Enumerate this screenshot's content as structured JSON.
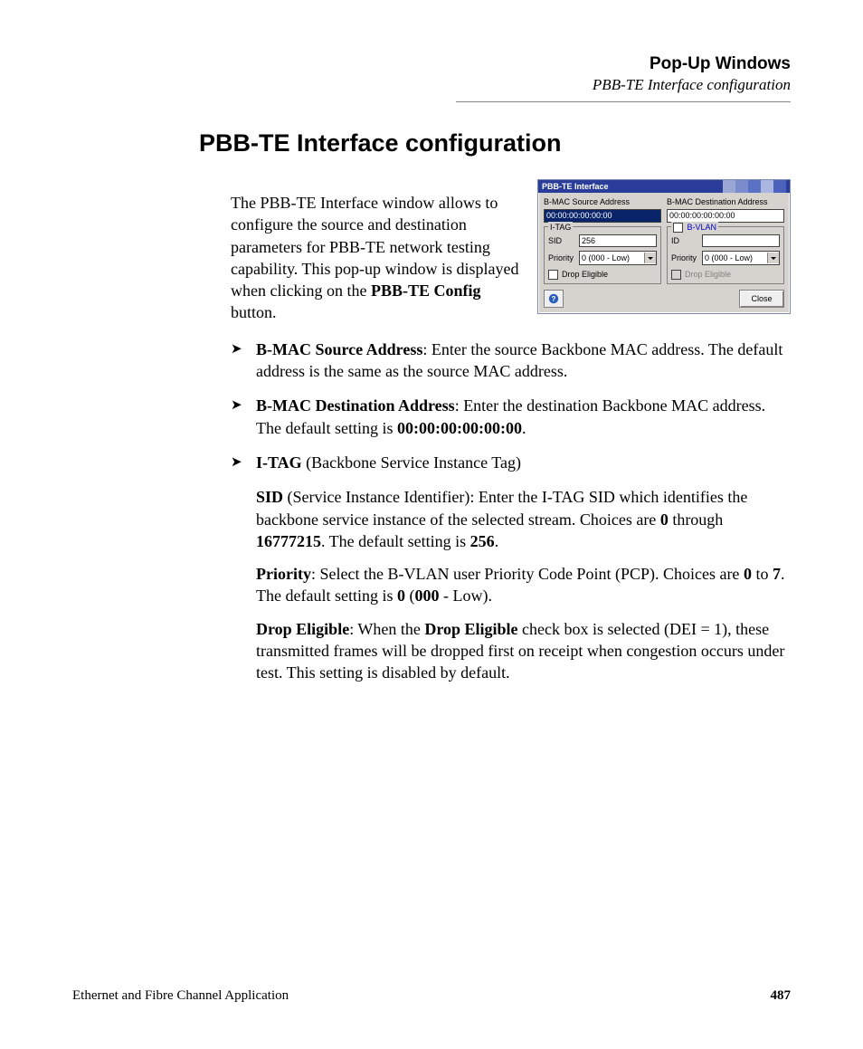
{
  "header": {
    "chapter": "Pop-Up Windows",
    "section": "PBB-TE Interface configuration"
  },
  "title": "PBB-TE Interface configuration",
  "intro": {
    "pre": "The PBB-TE Interface window allows to configure the source and destination parameters for PBB-TE network testing capability. This pop-up window is displayed when clicking on the ",
    "bold": "PBB-TE Config",
    "post": " button."
  },
  "bullets": {
    "b1": {
      "label": "B-MAC Source Address",
      "text": ": Enter the source Backbone MAC address. The default address is the same as the source MAC address."
    },
    "b2": {
      "label": "B-MAC Destination Address",
      "text": ": Enter the destination Backbone MAC address. The default setting is ",
      "value": "00:00:00:00:00:00",
      "post": "."
    },
    "b3": {
      "label": "I-TAG",
      "text": " (Backbone Service Instance Tag)"
    }
  },
  "sub": {
    "sid": {
      "label": "SID",
      "t1": " (Service Instance Identifier): Enter the I-TAG SID which identifies the backbone service instance of the selected stream. Choices are ",
      "v1": "0",
      "t2": " through ",
      "v2": "16777215",
      "t3": ". The default setting is ",
      "v3": "256",
      "t4": "."
    },
    "prio": {
      "label": "Priority",
      "t1": ": Select the B-VLAN user Priority Code Point (PCP). Choices are ",
      "v1": "0",
      "t2": " to ",
      "v2": "7",
      "t3": ". The default setting is ",
      "v3": "0",
      "t4": " (",
      "v4": "000",
      "t5": " - Low)."
    },
    "drop": {
      "label": "Drop Eligible",
      "t1": ": When the ",
      "label2": "Drop Eligible",
      "t2": " check box is selected (DEI = 1), these transmitted frames will be dropped first on receipt when congestion occurs under test. This setting is disabled by default."
    }
  },
  "dialog": {
    "title": "PBB-TE Interface",
    "src_label": "B-MAC Source Address",
    "src_value": "00:00:00:00:00:00",
    "dst_label": "B-MAC Destination Address",
    "dst_value": "00:00:00:00:00:00",
    "itag_legend": "I-TAG",
    "bvlan_legend": "B-VLAN",
    "sid_label": "SID",
    "sid_value": "256",
    "id_label": "ID",
    "id_value": "",
    "priority_label": "Priority",
    "priority_value": "0 (000 - Low)",
    "drop_label": "Drop Eligible",
    "close": "Close"
  },
  "footer": {
    "left": "Ethernet and Fibre Channel Application",
    "page": "487"
  }
}
